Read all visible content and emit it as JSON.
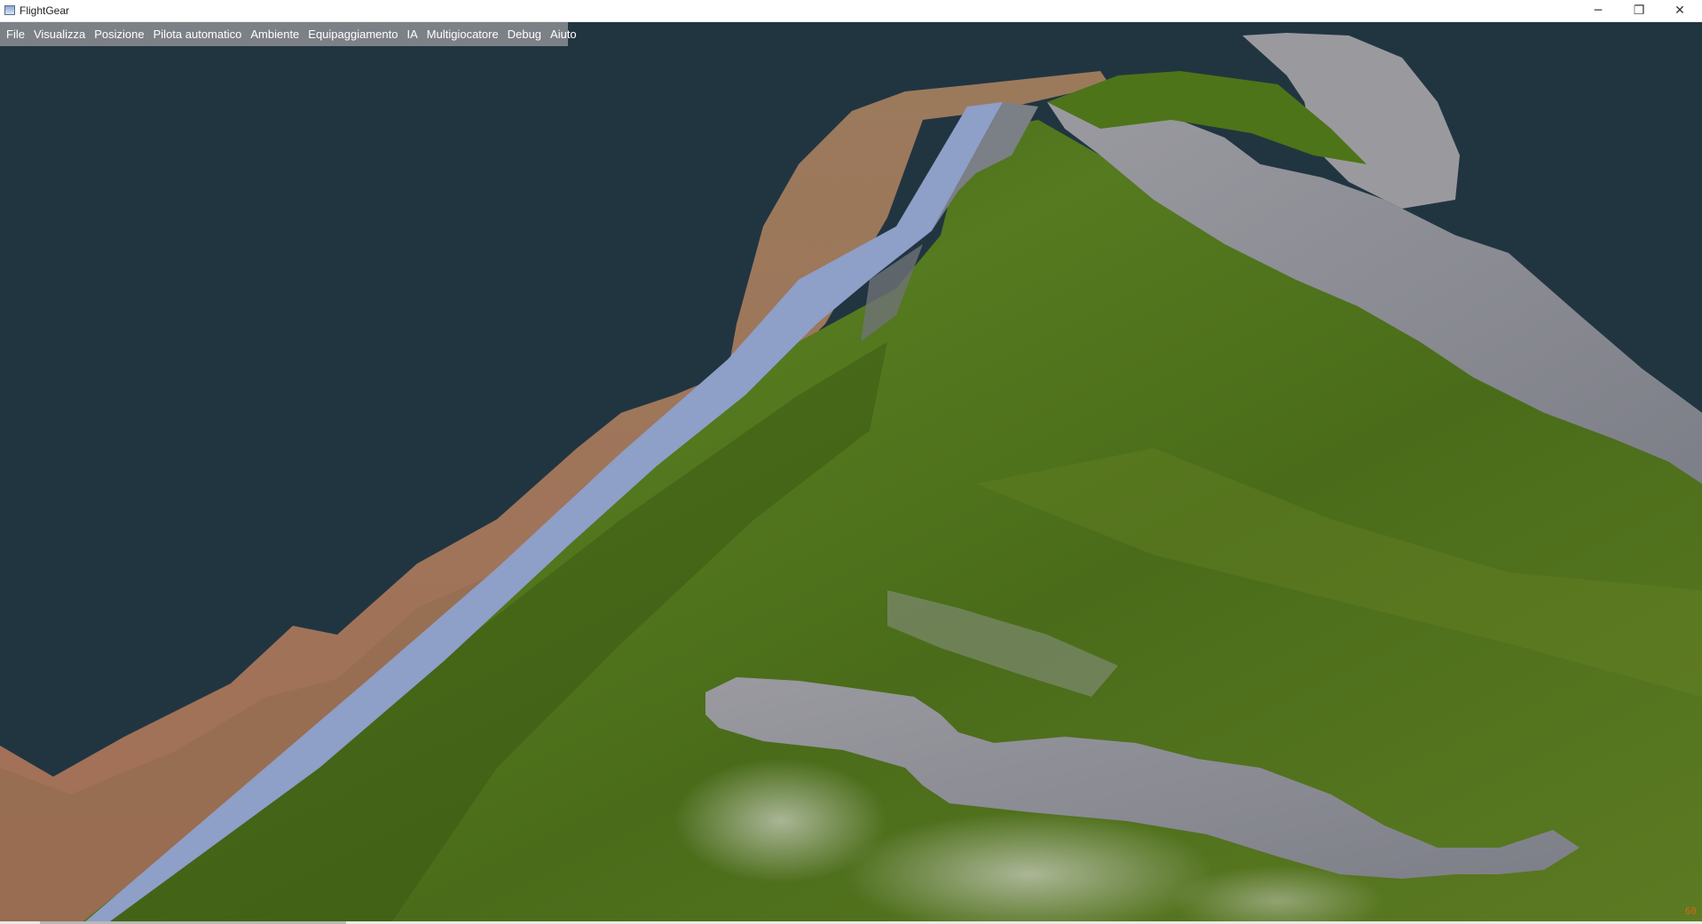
{
  "window": {
    "title": "FlightGear",
    "minimize_glyph": "─",
    "restore_glyph": "❐",
    "close_glyph": "✕"
  },
  "menubar": {
    "items": [
      {
        "label": "File"
      },
      {
        "label": "Visualizza"
      },
      {
        "label": "Posizione"
      },
      {
        "label": "Pilota automatico"
      },
      {
        "label": "Ambiente"
      },
      {
        "label": "Equipaggiamento"
      },
      {
        "label": "IA"
      },
      {
        "label": "Multigiocatore"
      },
      {
        "label": "Debug"
      },
      {
        "label": "Aiuto"
      }
    ]
  },
  "hud": {
    "fps": "60"
  },
  "colors": {
    "sky": "#213541",
    "grass": "#4f6e1d",
    "rock": "#8a8a90",
    "cliff": "#a8765a",
    "road": "#8e9fc8",
    "fps_text": "#d2691e"
  }
}
